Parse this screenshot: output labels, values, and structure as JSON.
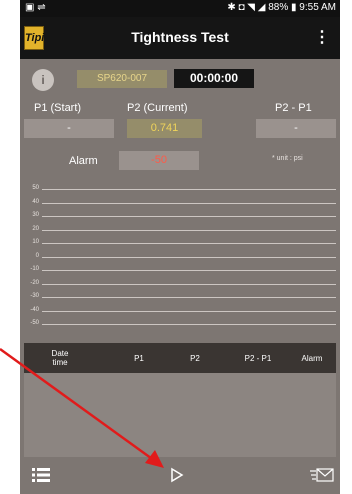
{
  "status_bar": {
    "left_icons": "▣ ⇌",
    "right_text": "✱ ◘ ◥ ◢ 88% ▮ 9:55 AM"
  },
  "app_bar": {
    "logo_text": "Tipi",
    "title": "Tightness Test",
    "menu_icon": "more-vert-icon"
  },
  "test_info": {
    "device_id": "SP620-007",
    "timer": "00:00:00"
  },
  "pressure": {
    "p1_label": "P1 (Start)",
    "p1_value": "-",
    "p2_label": "P2 (Current)",
    "p2_value": "0.741",
    "diff_label": "P2 - P1",
    "diff_value": "-"
  },
  "alarm": {
    "label": "Alarm",
    "value": "-50",
    "unit_note": "* unit : psi"
  },
  "chart": {
    "y_ticks": [
      "50",
      "40",
      "30",
      "20",
      "10",
      "0",
      "-10",
      "-20",
      "-30",
      "-40",
      "-50"
    ]
  },
  "table": {
    "headers": [
      "Date\ntime",
      "P1",
      "P2",
      "P2 - P1",
      "Alarm"
    ]
  },
  "bottom_bar": {
    "list_icon": "list-icon",
    "play_icon": "play-icon",
    "mail_icon": "send-mail-icon"
  },
  "colors": {
    "background": "#7d7672",
    "bar": "#151515",
    "accent_yellow": "#e2b32b",
    "alarm_red": "#ff5a48",
    "annotation_arrow": "#e11b1b"
  }
}
